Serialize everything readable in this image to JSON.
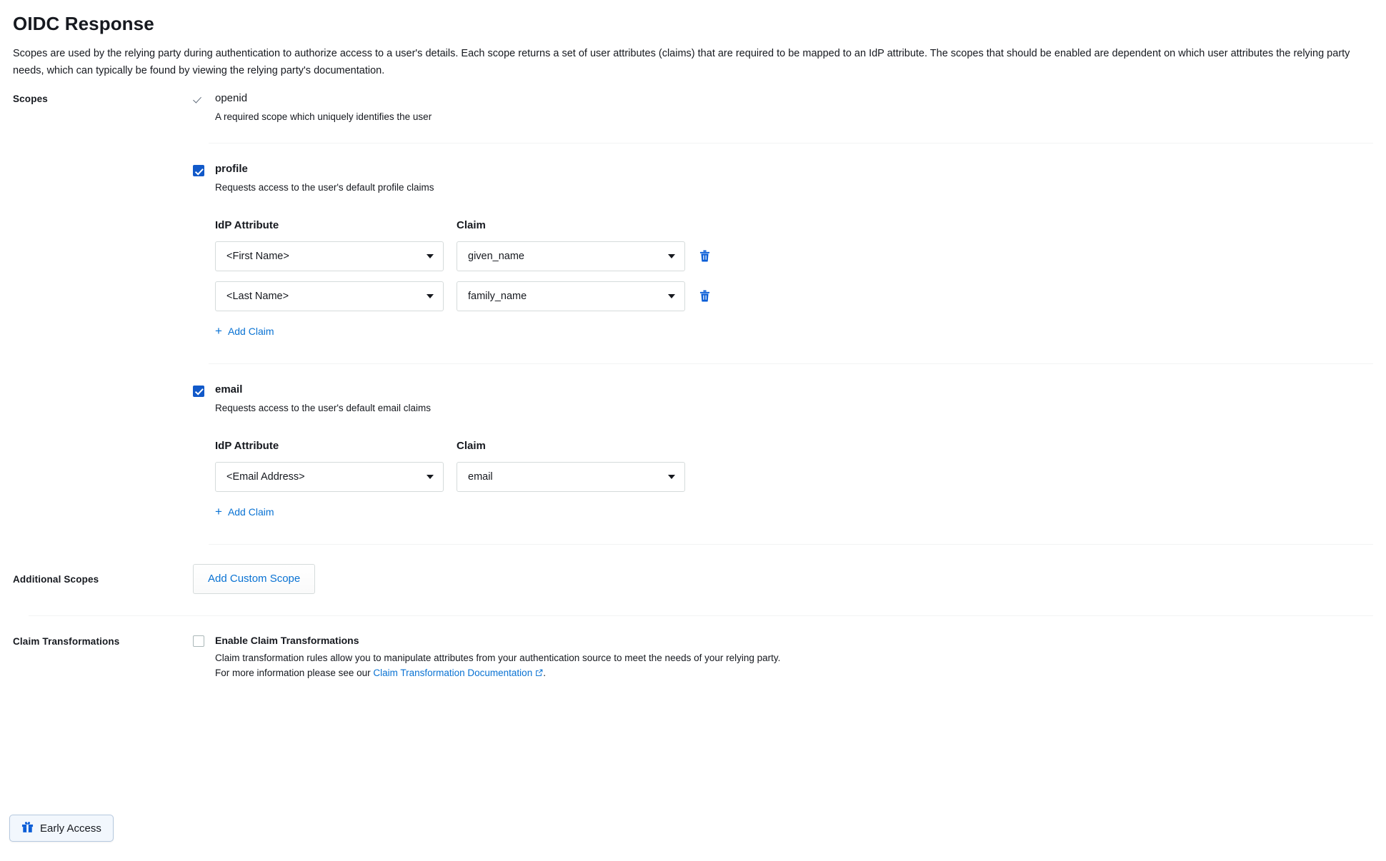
{
  "page": {
    "title": "OIDC Response",
    "description": "Scopes are used by the relying party during authentication to authorize access to a user's details. Each scope returns a set of user attributes (claims) that are required to be mapped to an IdP attribute. The scopes that should be enabled are dependent on which user attributes the relying party needs, which can typically be found by viewing the relying party's documentation."
  },
  "scopes_section": {
    "label": "Scopes",
    "scopes": [
      {
        "name": "openid",
        "description": "A required scope which uniquely identifies the user",
        "checkbox_state": "checkmark-readonly",
        "has_claims": false
      },
      {
        "name": "profile",
        "description": "Requests access to the user's default profile claims",
        "checkbox_state": "checked",
        "has_claims": true,
        "claims_table": {
          "headers": {
            "idp_attribute": "IdP Attribute",
            "claim": "Claim"
          },
          "rows": [
            {
              "idp_attribute": "<First Name>",
              "claim": "given_name"
            },
            {
              "idp_attribute": "<Last Name>",
              "claim": "family_name"
            }
          ]
        },
        "add_claim_label": "Add Claim"
      },
      {
        "name": "email",
        "description": "Requests access to the user's default email claims",
        "checkbox_state": "checked",
        "has_claims": true,
        "claims_table": {
          "headers": {
            "idp_attribute": "IdP Attribute",
            "claim": "Claim"
          },
          "rows": [
            {
              "idp_attribute": "<Email Address>",
              "claim": "email"
            }
          ]
        },
        "add_claim_label": "Add Claim"
      }
    ]
  },
  "additional_scopes_section": {
    "label": "Additional Scopes",
    "add_custom_scope_label": "Add Custom Scope"
  },
  "claim_transformations_section": {
    "label": "Claim Transformations",
    "enable_label": "Enable Claim Transformations",
    "enabled": false,
    "description_before": "Claim transformation rules allow you to manipulate attributes from your authentication source to meet the needs of your relying party. For more information please see our ",
    "doc_link_label": "Claim Transformation Documentation",
    "description_after": "."
  },
  "early_access": {
    "label": "Early Access",
    "icon": "gift-icon"
  },
  "icons": {
    "delete": "trash-icon",
    "add": "plus-icon",
    "dropdown": "chevron-down-icon",
    "external_link": "external-link-icon"
  },
  "colors": {
    "accent_blue": "#0972d3",
    "checkbox_blue": "#1159c9",
    "text": "#16191f",
    "border": "#d5dbdb",
    "divider": "#f2f3f3"
  }
}
